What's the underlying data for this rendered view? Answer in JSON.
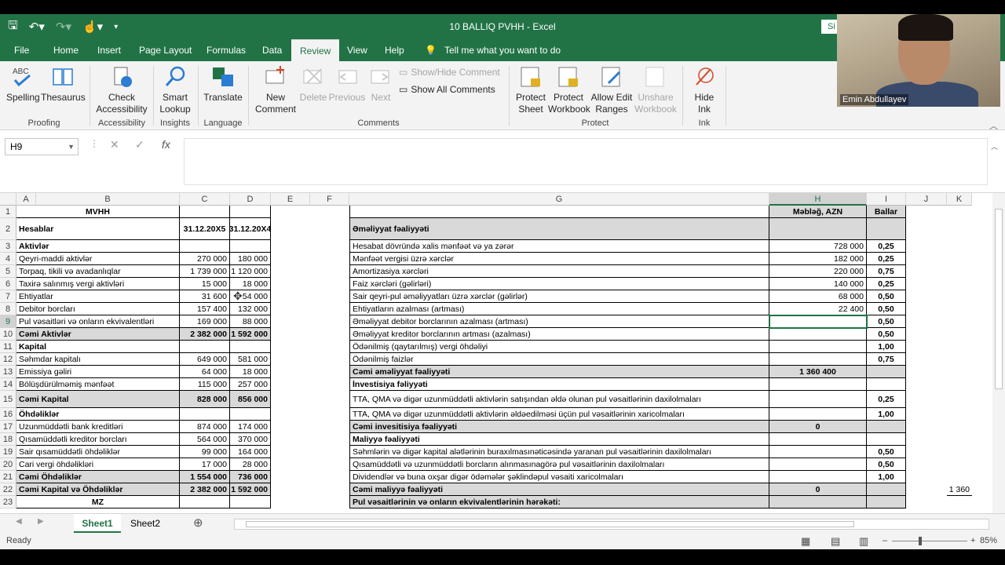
{
  "app": {
    "title": "10 BALLIQ PVHH  -  Excel",
    "signin": "Si"
  },
  "menu": [
    "File",
    "Home",
    "Insert",
    "Page Layout",
    "Formulas",
    "Data",
    "Review",
    "View",
    "Help"
  ],
  "menu_active": "Review",
  "tell_me": "Tell me what you want to do",
  "ribbon": {
    "spelling": "Spelling",
    "thesaurus": "Thesaurus",
    "proofing": "Proofing",
    "check_accessibility": "Check Accessibility",
    "accessibility": "Accessibility",
    "smart_lookup": "Smart Lookup",
    "insights": "Insights",
    "translate": "Translate",
    "language": "Language",
    "new_comment": "New Comment",
    "delete": "Delete",
    "previous": "Previous",
    "next": "Next",
    "show_hide_comment": "Show/Hide Comment",
    "show_all_comments": "Show All Comments",
    "comments": "Comments",
    "protect_sheet": "Protect Sheet",
    "protect_workbook": "Protect Workbook",
    "allow_edit_ranges": "Allow Edit Ranges",
    "unshare_workbook": "Unshare Workbook",
    "protect": "Protect",
    "hide_ink": "Hide Ink",
    "ink": "Ink"
  },
  "formula": {
    "namebox": "H9",
    "content": ""
  },
  "columns": [
    "A",
    "B",
    "C",
    "D",
    "E",
    "F",
    "G",
    "H",
    "I",
    "J",
    "K"
  ],
  "rows": [
    "1",
    "2",
    "3",
    "4",
    "5",
    "6",
    "7",
    "8",
    "9",
    "10",
    "11",
    "12",
    "13",
    "14",
    "15",
    "16",
    "17",
    "18",
    "19",
    "20",
    "21",
    "22",
    "23"
  ],
  "cells": {
    "A1": "MVHH",
    "A2": "Hesablar",
    "C2": "31.12.20X5",
    "D2": "31.12.20X4",
    "A3": "Aktivlər",
    "A4": "Qeyri-maddi aktivlər",
    "C4": "270 000",
    "D4": "180 000",
    "A5": "Torpaq, tikili və avadanlıqlar",
    "C5": "1 739 000",
    "D5": "1 120 000",
    "A6": "Taxirə salınmış vergi aktivləri",
    "C6": "15 000",
    "D6": "18 000",
    "A7": "Ehtiyatlar",
    "C7": "31 600",
    "D7": "54 000",
    "A8": "Debitor borcları",
    "C8": "157 400",
    "D8": "132 000",
    "A9": "Pul vəsaitləri və onların ekvivalentləri",
    "C9": "169 000",
    "D9": "88 000",
    "A10": "Cəmi Aktivlər",
    "C10": "2 382 000",
    "D10": "1 592 000",
    "A11": "Kapital",
    "A12": "Səhmdar kapitalı",
    "C12": "649 000",
    "D12": "581 000",
    "A13": "Emissiya gəliri",
    "C13": "64 000",
    "D13": "18 000",
    "A14": "Bölüşdürülməmiş mənfəət",
    "C14": "115 000",
    "D14": "257 000",
    "A15": "Cəmi Kapital",
    "C15": "828 000",
    "D15": "856 000",
    "A16": "Öhdəliklər",
    "A17": "Uzunmüddətli bank kreditləri",
    "C17": "874 000",
    "D17": "174 000",
    "A18": "Qısamüddətli kreditor borcları",
    "C18": "564 000",
    "D18": "370 000",
    "A19": "Sair qısamüddətli öhdəliklər",
    "C19": "99 000",
    "D19": "164 000",
    "A20": "Cari vergi öhdəlikləri",
    "C20": "17 000",
    "D20": "28 000",
    "A21": "Cəmi Öhdəliklər",
    "C21": "1 554 000",
    "D21": "736 000",
    "A22": "Cəmi Kapital və Öhdəliklər",
    "C22": "2 382 000",
    "D22": "1 592 000",
    "A23": "MZ",
    "H1": "Məbləğ, AZN",
    "I1": "Ballar",
    "G2": "Əməliyyat fəaliyyəti",
    "G3": "Hesabat dövründə xalis mənfəət və ya zərər",
    "H3": "728 000",
    "I3": "0,25",
    "G4": "Mənfəət vergisi üzrə xərclər",
    "H4": "182 000",
    "I4": "0,25",
    "G5": "Amortizasiya xərcləri",
    "H5": "220 000",
    "I5": "0,75",
    "G6": "Faiz xərcləri (gəlirləri)",
    "H6": "140 000",
    "I6": "0,25",
    "G7": "Sair qeyri-pul əməliyyatları üzrə xərclər (gəlirlər)",
    "H7": "68 000",
    "I7": "0,50",
    "G8": "Ehtiyatların azalması (artması)",
    "H8": "22 400",
    "I8": "0,50",
    "G9": "Əməliyyat debitor borclarının azalması (artması)",
    "H9": "",
    "I9": "0,50",
    "G10": "Əməliyyat kreditor borclarının artması (azalması)",
    "I10": "0,50",
    "G11": "Ödənilmiş (qaytarılmış) vergi öhdəliyi",
    "I11": "1,00",
    "G12": "Ödənilmiş faizlər",
    "I12": "0,75",
    "G13": "Cəmi əməliyyat fəaliyyəti",
    "H13": "1 360 400",
    "G14": "İnvestisiya fəliyyəti",
    "G15": "TTA,  QMA və digər uzunmüddətli aktivlərin satışından əldə olunan pul vəsaitlərinin daxilolmaları",
    "I15": "0,25",
    "G16": "TTA, QMA və digər uzunmüddətli aktivlərin əldəedilməsi üçün pul vəsaitlərinin xaricolmaları",
    "I16": "1,00",
    "G17": "Cəmi invesitisiya fəaliyyəti",
    "H17": "0",
    "G18": "Maliyyə fəaliyyəti",
    "G19": "Səhmlərin  və  digər  kapital  alətlərinin  buraxılmasınəticəsində yaranan pul vəsaitlərinin daxilolmaları",
    "I19": "0,50",
    "G20": "Qısamüddətli  və  uzunmüddətli borcların  alınmasınagörə pul vəsaitlərinin daxilolmaları",
    "I20": "0,50",
    "G21": "Dividendlər  və  buna  oxşar  digər  ödəmələr  şəklindəpul vəsaiti xaricolmaları",
    "I21": "1,00",
    "G22": "Cəmi maliyyə fəaliyyəti",
    "H22": "0",
    "K22": "1 360",
    "G23": "Pul vəsaitlərinin və onların ekvivalentlərinin hərəkəti:"
  },
  "sheets": [
    "Sheet1",
    "Sheet2"
  ],
  "active_sheet": "Sheet1",
  "status": {
    "ready": "Ready",
    "zoom": "85%"
  },
  "webcam": {
    "name": "Emin Abdullayev"
  }
}
